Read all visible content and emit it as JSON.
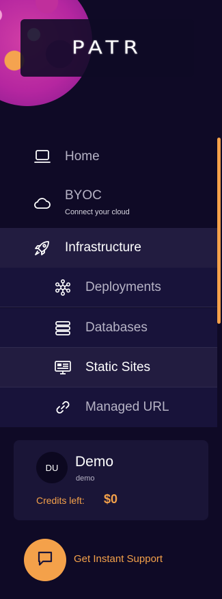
{
  "brand": {
    "logo_text": "PATR"
  },
  "nav": {
    "home": {
      "label": "Home",
      "icon": "laptop-icon"
    },
    "byoc": {
      "label": "BYOC",
      "sublabel": "Connect your cloud",
      "icon": "cloud-icon"
    },
    "infrastructure": {
      "label": "Infrastructure",
      "icon": "rocket-icon",
      "children": [
        {
          "label": "Deployments",
          "icon": "deployments-icon"
        },
        {
          "label": "Databases",
          "icon": "database-icon"
        },
        {
          "label": "Static Sites",
          "icon": "static-sites-icon",
          "selected": true
        },
        {
          "label": "Managed URL",
          "icon": "link-icon"
        }
      ]
    }
  },
  "user": {
    "initials": "DU",
    "name": "Demo",
    "handle": "demo",
    "credits_label": "Credits left:",
    "credits_value": "$0"
  },
  "support": {
    "label": "Get Instant Support",
    "icon": "chat-icon"
  },
  "colors": {
    "background": "#0f0a26",
    "accent": "#f4a14a",
    "active_bg": "#221c40",
    "submenu_bg": "#18133a"
  }
}
